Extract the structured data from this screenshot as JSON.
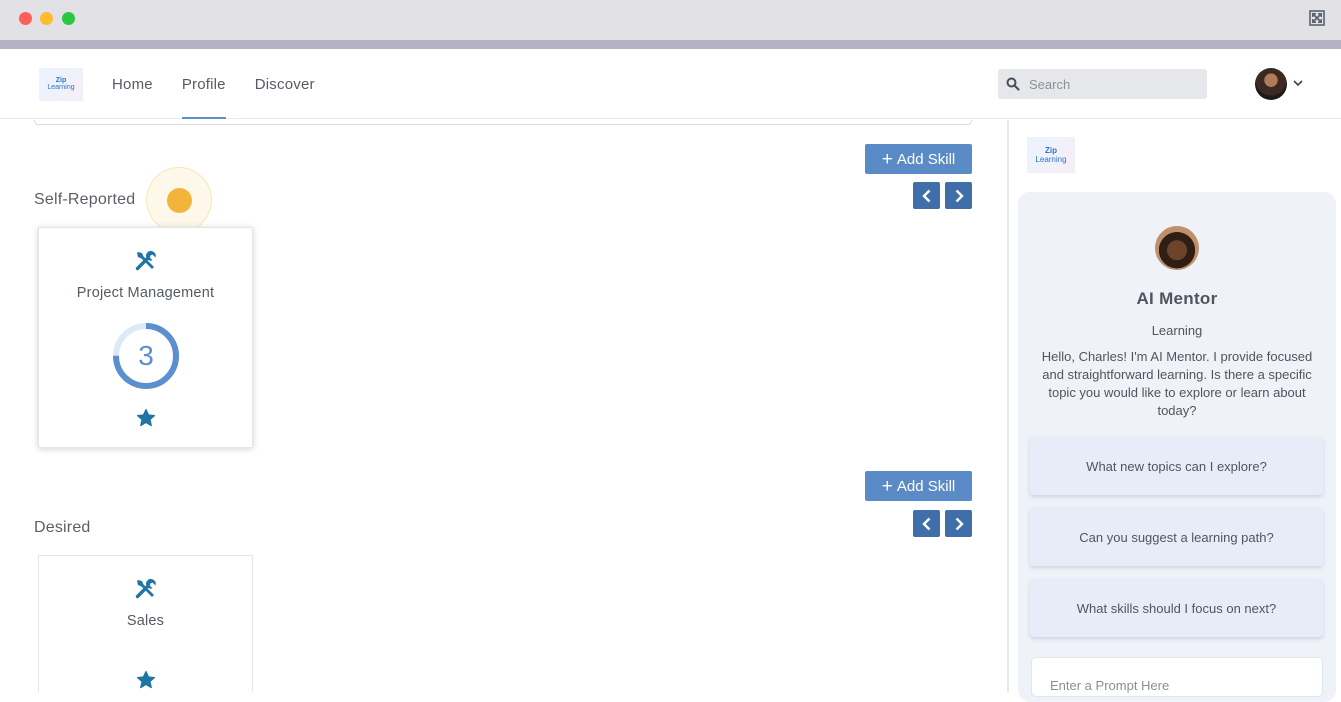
{
  "header": {
    "logo_line1": "Zip",
    "logo_line2": "Learning",
    "nav": [
      "Home",
      "Profile",
      "Discover"
    ],
    "active_nav": "Profile",
    "search_placeholder": "Search"
  },
  "skills": {
    "add_skill_label": "Add Skill",
    "add_skill_icon": "plus-icon",
    "self_reported": {
      "title": "Self-Reported",
      "cards": [
        {
          "label": "Project Management",
          "level": "3",
          "level_fraction": 0.75,
          "icon": "tools-icon"
        }
      ]
    },
    "desired": {
      "title": "Desired",
      "cards": [
        {
          "label": "Sales",
          "icon": "tools-icon"
        }
      ]
    }
  },
  "mentor": {
    "logo_line1": "Zip",
    "logo_line2": "Learning",
    "name": "AI Mentor",
    "role": "Learning",
    "message": "Hello, Charles! I'm AI Mentor. I provide focused and straightforward learning. Is there a specific topic you would like to explore or learn about today?",
    "suggestions": [
      "What new topics can I explore?",
      "Can you suggest a learning path?",
      "What skills should I focus on next?"
    ],
    "prompt_placeholder": "Enter a Prompt Here"
  },
  "colors": {
    "accent": "#5a8bc6",
    "arrow_button": "#3f6ea8",
    "icon": "#1f76a6",
    "cursor_dot": "#f3b43c"
  }
}
